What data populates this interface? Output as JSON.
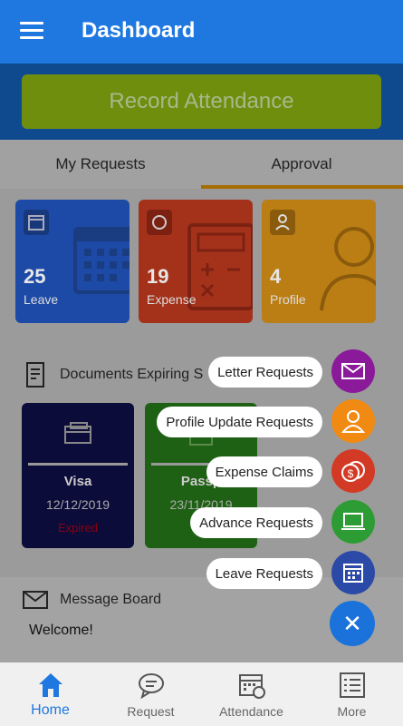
{
  "appbar": {
    "title": "Dashboard"
  },
  "record": {
    "label": "Record Attendance"
  },
  "tabs": [
    {
      "label": "My Requests"
    },
    {
      "label": "Approval"
    }
  ],
  "cards": [
    {
      "count": "25",
      "label": "Leave",
      "color": "#1d4aa6"
    },
    {
      "count": "19",
      "label": "Expense",
      "color": "#a4321b"
    },
    {
      "count": "4",
      "label": "Profile",
      "color": "#bb7e14"
    }
  ],
  "documents": {
    "title": "Documents Expiring S",
    "items": [
      {
        "name": "Visa",
        "date": "12/12/2019",
        "status": "Expired",
        "color": "#0c0c3a"
      },
      {
        "name": "Passp",
        "date": "23/11/2019",
        "status": "Ex",
        "color": "#1f6114"
      }
    ]
  },
  "message_board": {
    "title": "Message Board",
    "text": "Welcome!"
  },
  "fab_menu": [
    {
      "label": "Letter Requests",
      "icon": "envelope-icon",
      "color": "#8a1a9a"
    },
    {
      "label": "Profile Update Requests",
      "icon": "person-icon",
      "color": "#f08a12"
    },
    {
      "label": "Expense Claims",
      "icon": "coins-icon",
      "color": "#d33a25"
    },
    {
      "label": "Advance Requests",
      "icon": "laptop-icon",
      "color": "#2e9c34"
    },
    {
      "label": "Leave Requests",
      "icon": "calendar-icon",
      "color": "#2b4aa8"
    }
  ],
  "bottom_nav": [
    {
      "label": "Home",
      "icon": "home-icon"
    },
    {
      "label": "Request",
      "icon": "chat-icon"
    },
    {
      "label": "Attendance",
      "icon": "attendance-icon"
    },
    {
      "label": "More",
      "icon": "list-icon"
    }
  ]
}
